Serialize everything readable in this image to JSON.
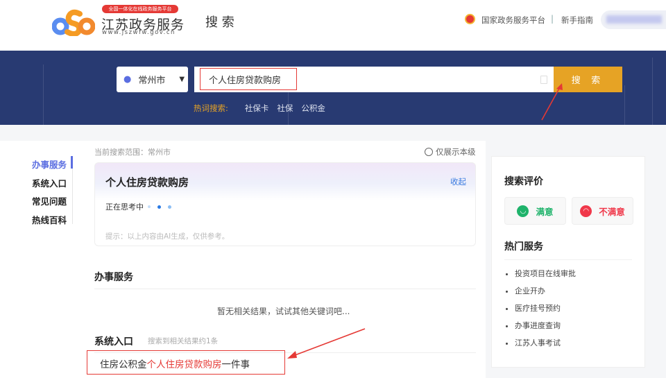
{
  "header": {
    "logo_badge": "全国一体化在线政务服务平台",
    "logo_title": "江苏政务服务",
    "logo_url": "www.jszwfw.gov.cn",
    "page_title": "搜 索",
    "national_platform": "国家政务服务平台",
    "separator": "|",
    "guide": "新手指南"
  },
  "search": {
    "city": "常州市",
    "query": "个人住房贷款购房",
    "button": "搜 索",
    "hot_label": "热词搜索:",
    "hot_words": [
      "社保卡",
      "社保",
      "公积金"
    ]
  },
  "sidebar": {
    "items": [
      {
        "label": "办事服务",
        "active": true
      },
      {
        "label": "系统入口"
      },
      {
        "label": "常见问题"
      },
      {
        "label": "热线百科"
      }
    ]
  },
  "main": {
    "scope": "当前搜索范围：常州市",
    "only_level": "仅展示本级",
    "ai": {
      "title": "个人住房贷款购房",
      "collapse": "收起",
      "thinking": "正在思考中",
      "hint": "提示：以上内容由AI生成，仅供参考。"
    },
    "service_title": "办事服务",
    "no_result": "暂无相关结果，试试其他关键词吧...",
    "system_title": "系统入口",
    "system_count": "搜索到相关结果约1条",
    "result": {
      "prefix": "住房公积金",
      "highlight": "个人住房贷款购房",
      "suffix": "一件事"
    }
  },
  "right": {
    "eval_title": "搜索评价",
    "satisfied": "满意",
    "unsatisfied": "不满意",
    "hot_title": "热门服务",
    "hot_services": [
      "投资项目在线审批",
      "企业开办",
      "医疗挂号预约",
      "办事进度查询",
      "江苏人事考试"
    ]
  },
  "colors": {
    "navy": "#283a72",
    "orange": "#e6a325",
    "red": "#e53935",
    "green": "#1fb36b",
    "accent": "#5b6ee1"
  }
}
